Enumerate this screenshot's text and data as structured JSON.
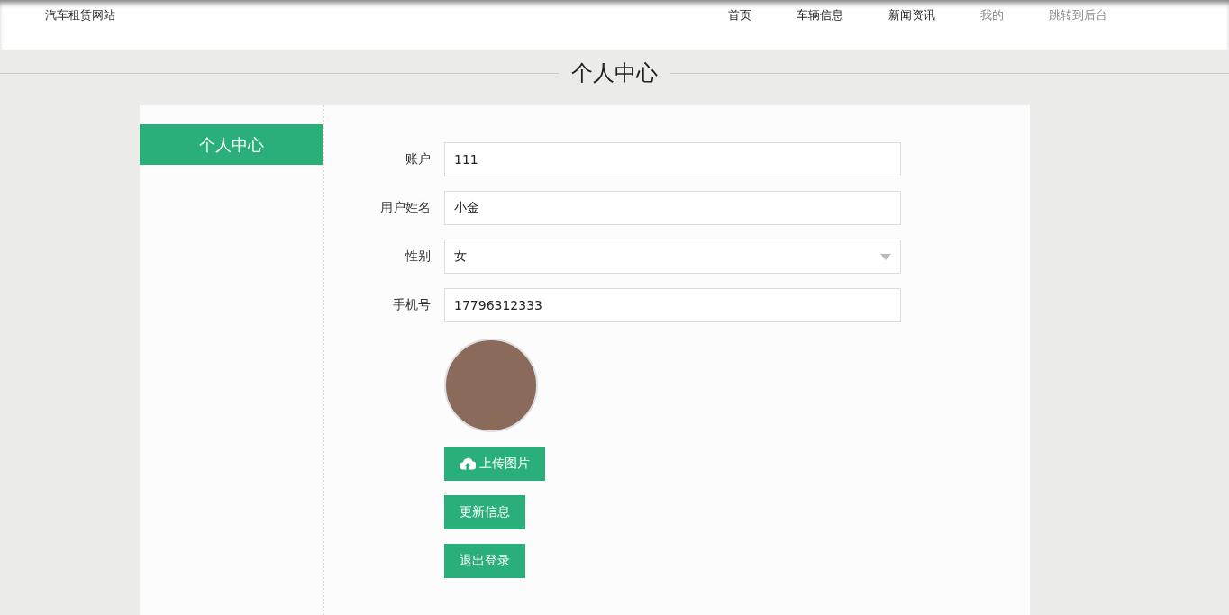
{
  "site_title": "汽车租赁网站",
  "nav": [
    {
      "label": "首页",
      "dimmed": false
    },
    {
      "label": "车辆信息",
      "dimmed": false
    },
    {
      "label": "新闻资讯",
      "dimmed": false
    },
    {
      "label": "我的",
      "dimmed": true
    },
    {
      "label": "跳转到后台",
      "dimmed": true
    }
  ],
  "page_title": "个人中心",
  "sidebar": {
    "items": [
      {
        "label": "个人中心",
        "selected": true
      }
    ]
  },
  "form": {
    "fields": [
      {
        "label": "账户",
        "kind": "text",
        "value": "111"
      },
      {
        "label": "用户姓名",
        "kind": "text",
        "value": "小金"
      },
      {
        "label": "性别",
        "kind": "select",
        "value": "女"
      },
      {
        "label": "手机号",
        "kind": "text",
        "value": "17796312333"
      }
    ],
    "buttons": [
      {
        "label": "上传图片",
        "kind": "upload"
      },
      {
        "label": "更新信息",
        "kind": "plain"
      },
      {
        "label": "退出登录",
        "kind": "plain"
      }
    ]
  }
}
